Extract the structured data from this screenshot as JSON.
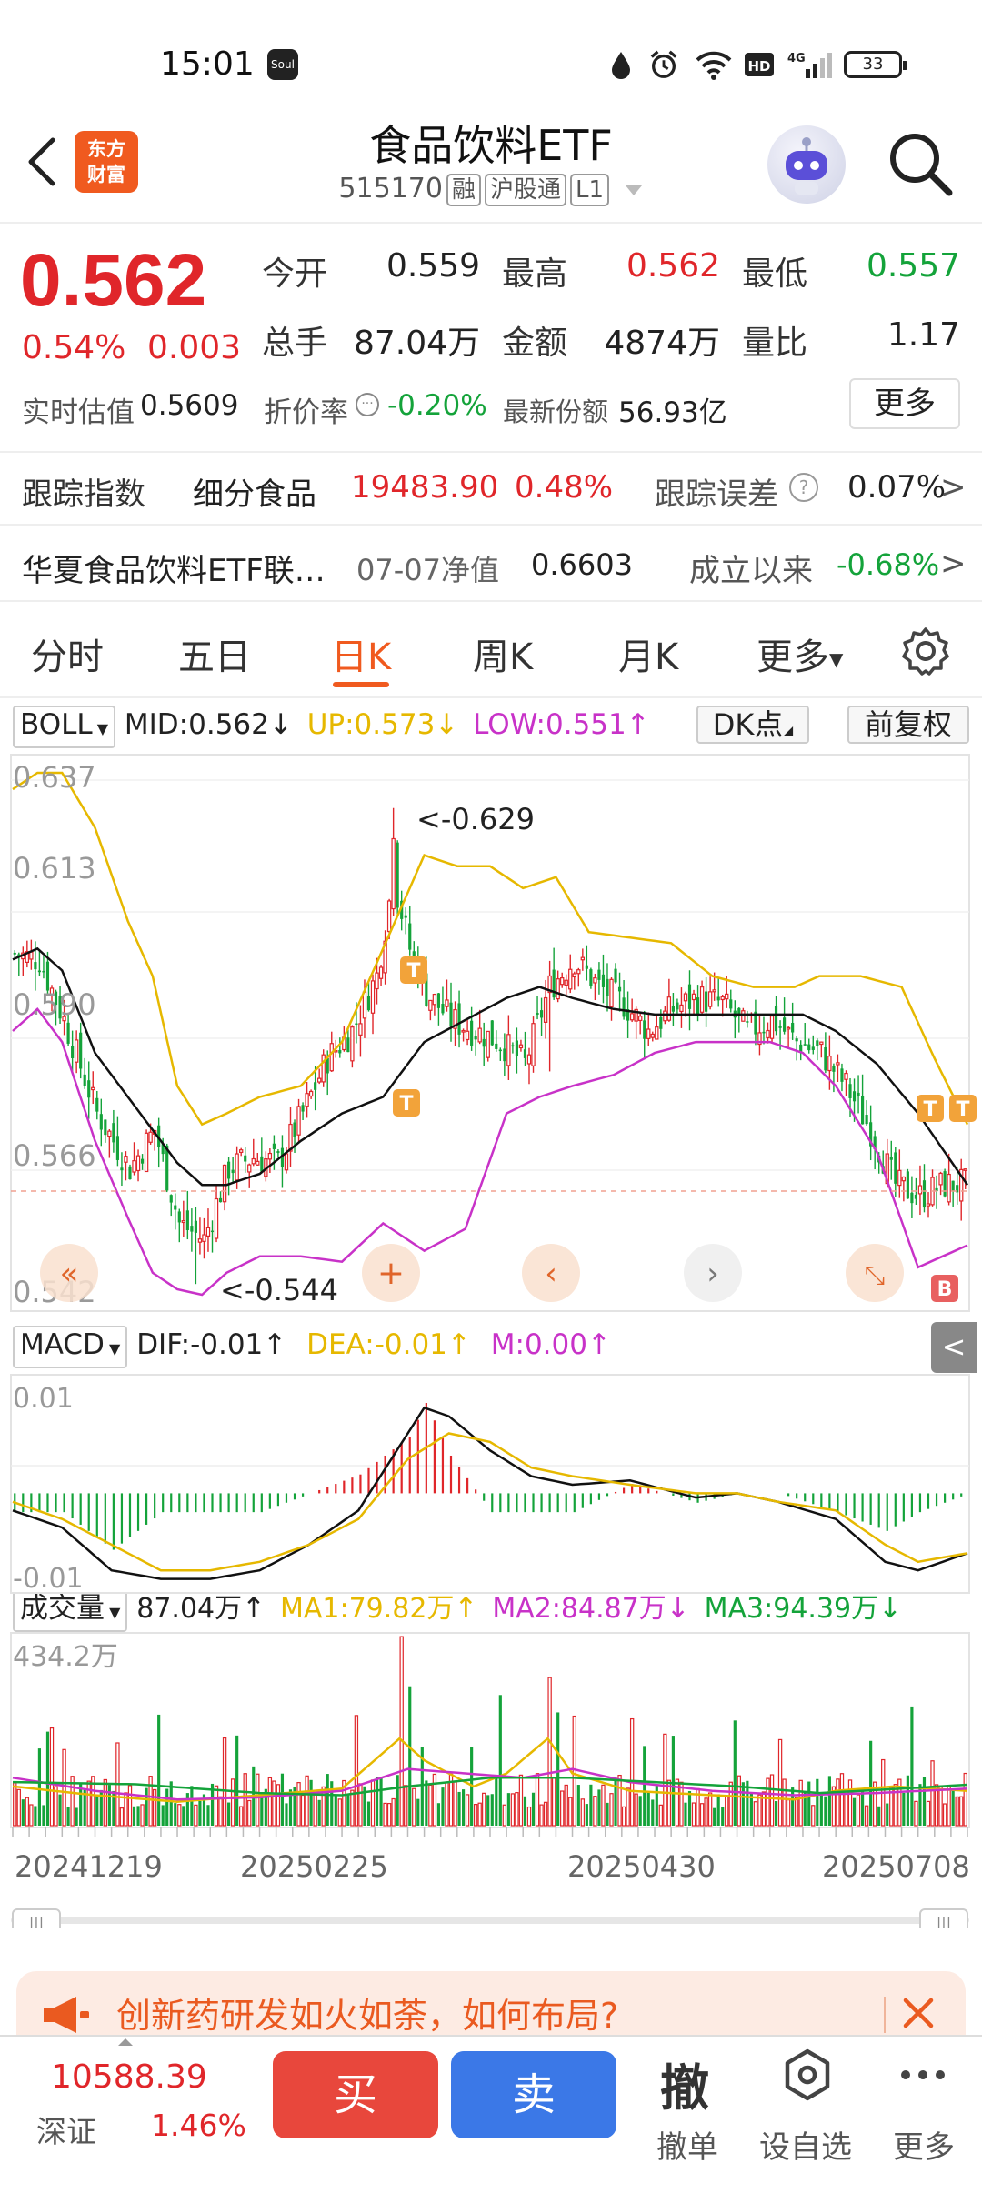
{
  "status_bar": {
    "time": "15:01",
    "app_badge": "Soul",
    "battery": "33"
  },
  "header": {
    "brand": [
      "东方",
      "财富"
    ],
    "title": "食品饮料ETF",
    "code": "515170",
    "tags": [
      "融",
      "沪股通",
      "L1"
    ]
  },
  "quote": {
    "price": "0.562",
    "change_pct": "0.54%",
    "change": "0.003",
    "fields": [
      {
        "label": "今开",
        "value": "0.559",
        "color": "#222222"
      },
      {
        "label": "最高",
        "value": "0.562",
        "color": "#e0262a"
      },
      {
        "label": "最低",
        "value": "0.557",
        "color": "#14a33a"
      },
      {
        "label": "总手",
        "value": "87.04万",
        "color": "#222222"
      },
      {
        "label": "金额",
        "value": "4874万",
        "color": "#222222"
      },
      {
        "label": "量比",
        "value": "1.17",
        "color": "#222222"
      }
    ],
    "est_label": "实时估值",
    "est_value": "0.5609",
    "discount_label": "折价率",
    "discount_value": "-0.20%",
    "shares_label": "最新份额",
    "shares_value": "56.93亿",
    "more_label": "更多"
  },
  "tracking": {
    "label": "跟踪指数",
    "index_name": "细分食品",
    "index_value": "19483.90",
    "index_pct": "0.48%",
    "error_label": "跟踪误差",
    "error_value": "0.07%"
  },
  "fund": {
    "name": "华夏食品饮料ETF联…",
    "nav_label": "07-07净值",
    "nav_value": "0.6603",
    "since_label": "成立以来",
    "since_value": "-0.68%"
  },
  "tabs": [
    "分时",
    "五日",
    "日K",
    "周K",
    "月K",
    "更多"
  ],
  "active_tab": 2,
  "boll": {
    "name": "BOLL",
    "mid": "MID:0.562",
    "up": "UP:0.573",
    "low": "LOW:0.551",
    "dk_label": "DK点",
    "adj_label": "前复权"
  },
  "macd": {
    "name": "MACD",
    "dif": "DIF:-0.01",
    "dea": "DEA:-0.01",
    "m": "M:0.00",
    "y_top": "0.01",
    "y_bottom": "-0.01"
  },
  "volume": {
    "name": "成交量",
    "value": "87.04万",
    "ma1": "MA1:79.82万",
    "ma2": "MA2:84.87万",
    "ma3": "MA3:94.39万",
    "y_top": "434.2万"
  },
  "price_axis": [
    "0.637",
    "0.613",
    "0.590",
    "0.566",
    "0.542"
  ],
  "price_annotations": {
    "high": "<-0.629",
    "low": "<-0.544"
  },
  "date_axis": [
    "20241219",
    "20250225",
    "20250430",
    "20250708"
  ],
  "ad": {
    "text": "创新药研发如火如荼，如何布局?"
  },
  "bottom": {
    "index_value": "10588.39",
    "index_name": "深证",
    "index_pct": "1.46%",
    "buy": "买",
    "sell": "卖",
    "cancel_glyph": "撤",
    "cancel_label": "撤单",
    "watch_label": "设自选",
    "more_label": "更多"
  },
  "colors": {
    "up": "#e0262a",
    "down": "#14a33a",
    "accent": "#f05a1f",
    "boll_up": "#e6b800",
    "boll_low": "#c832c8"
  },
  "chart_data": {
    "type": "candlestick",
    "x_range": [
      "20241219",
      "20250708"
    ],
    "price_ylim": [
      0.542,
      0.637
    ],
    "close_path_approx": [
      [
        0,
        0.604
      ],
      [
        6,
        0.603
      ],
      [
        12,
        0.592
      ],
      [
        20,
        0.575
      ],
      [
        28,
        0.565
      ],
      [
        34,
        0.572
      ],
      [
        40,
        0.555
      ],
      [
        46,
        0.552
      ],
      [
        52,
        0.565
      ],
      [
        58,
        0.567
      ],
      [
        64,
        0.566
      ],
      [
        70,
        0.575
      ],
      [
        76,
        0.585
      ],
      [
        82,
        0.59
      ],
      [
        88,
        0.6
      ],
      [
        92,
        0.618
      ],
      [
        96,
        0.605
      ],
      [
        100,
        0.597
      ],
      [
        106,
        0.592
      ],
      [
        112,
        0.59
      ],
      [
        118,
        0.588
      ],
      [
        124,
        0.584
      ],
      [
        130,
        0.598
      ],
      [
        136,
        0.603
      ],
      [
        142,
        0.598
      ],
      [
        148,
        0.595
      ],
      [
        154,
        0.59
      ],
      [
        160,
        0.594
      ],
      [
        166,
        0.596
      ],
      [
        172,
        0.595
      ],
      [
        178,
        0.59
      ],
      [
        184,
        0.592
      ],
      [
        190,
        0.588
      ],
      [
        196,
        0.586
      ],
      [
        202,
        0.58
      ],
      [
        208,
        0.572
      ],
      [
        214,
        0.562
      ],
      [
        220,
        0.56
      ],
      [
        226,
        0.562
      ],
      [
        232,
        0.562
      ]
    ],
    "boll_up_path_approx": [
      [
        0,
        0.634
      ],
      [
        6,
        0.637
      ],
      [
        12,
        0.637
      ],
      [
        20,
        0.627
      ],
      [
        28,
        0.61
      ],
      [
        34,
        0.6
      ],
      [
        40,
        0.58
      ],
      [
        46,
        0.573
      ],
      [
        52,
        0.575
      ],
      [
        60,
        0.578
      ],
      [
        70,
        0.58
      ],
      [
        80,
        0.588
      ],
      [
        90,
        0.605
      ],
      [
        100,
        0.622
      ],
      [
        108,
        0.62
      ],
      [
        116,
        0.62
      ],
      [
        124,
        0.616
      ],
      [
        132,
        0.618
      ],
      [
        140,
        0.608
      ],
      [
        150,
        0.607
      ],
      [
        160,
        0.606
      ],
      [
        170,
        0.6
      ],
      [
        180,
        0.598
      ],
      [
        190,
        0.598
      ],
      [
        196,
        0.6
      ],
      [
        206,
        0.6
      ],
      [
        216,
        0.598
      ],
      [
        224,
        0.585
      ],
      [
        232,
        0.573
      ]
    ],
    "boll_mid_path_approx": [
      [
        0,
        0.603
      ],
      [
        6,
        0.605
      ],
      [
        12,
        0.601
      ],
      [
        20,
        0.586
      ],
      [
        28,
        0.578
      ],
      [
        34,
        0.572
      ],
      [
        40,
        0.566
      ],
      [
        46,
        0.562
      ],
      [
        52,
        0.562
      ],
      [
        60,
        0.564
      ],
      [
        70,
        0.57
      ],
      [
        80,
        0.575
      ],
      [
        90,
        0.578
      ],
      [
        100,
        0.588
      ],
      [
        110,
        0.592
      ],
      [
        120,
        0.596
      ],
      [
        128,
        0.598
      ],
      [
        136,
        0.596
      ],
      [
        146,
        0.594
      ],
      [
        156,
        0.593
      ],
      [
        166,
        0.593
      ],
      [
        176,
        0.593
      ],
      [
        184,
        0.593
      ],
      [
        192,
        0.593
      ],
      [
        200,
        0.59
      ],
      [
        210,
        0.584
      ],
      [
        220,
        0.575
      ],
      [
        232,
        0.562
      ]
    ],
    "boll_low_path_approx": [
      [
        0,
        0.59
      ],
      [
        6,
        0.594
      ],
      [
        12,
        0.588
      ],
      [
        20,
        0.57
      ],
      [
        28,
        0.556
      ],
      [
        34,
        0.546
      ],
      [
        40,
        0.543
      ],
      [
        46,
        0.542
      ],
      [
        52,
        0.546
      ],
      [
        60,
        0.549
      ],
      [
        70,
        0.549
      ],
      [
        80,
        0.548
      ],
      [
        90,
        0.555
      ],
      [
        100,
        0.55
      ],
      [
        110,
        0.554
      ],
      [
        120,
        0.575
      ],
      [
        128,
        0.578
      ],
      [
        136,
        0.58
      ],
      [
        146,
        0.582
      ],
      [
        156,
        0.586
      ],
      [
        166,
        0.588
      ],
      [
        176,
        0.588
      ],
      [
        184,
        0.588
      ],
      [
        192,
        0.586
      ],
      [
        200,
        0.58
      ],
      [
        210,
        0.568
      ],
      [
        220,
        0.547
      ],
      [
        232,
        0.551
      ]
    ],
    "macd_ylim": [
      -0.011,
      0.013
    ],
    "volume_ylim": [
      0,
      434.2
    ]
  }
}
